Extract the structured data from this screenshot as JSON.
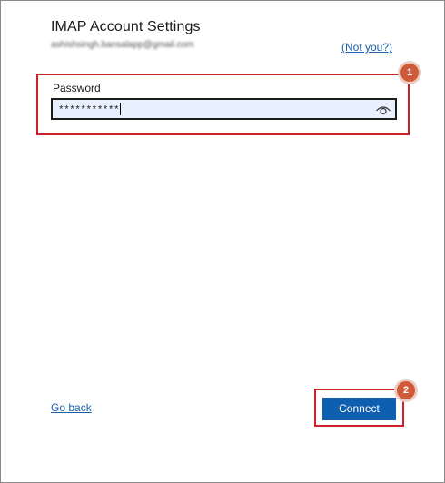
{
  "header": {
    "title": "IMAP Account Settings",
    "email": "ashishsingh.bansalapp@gmail.com",
    "not_you_label": "(Not you?)"
  },
  "password": {
    "label": "Password",
    "masked_value": "***********",
    "reveal_icon": "eye-icon"
  },
  "footer": {
    "go_back_label": "Go back",
    "connect_label": "Connect"
  },
  "annotations": {
    "step1": "1",
    "step2": "2",
    "highlight_color": "#d0202a",
    "badge_color": "#cf5a3a"
  },
  "colors": {
    "link": "#1a5fa8",
    "primary_button": "#0e5fb0",
    "field_fill": "#e8f0fe"
  }
}
